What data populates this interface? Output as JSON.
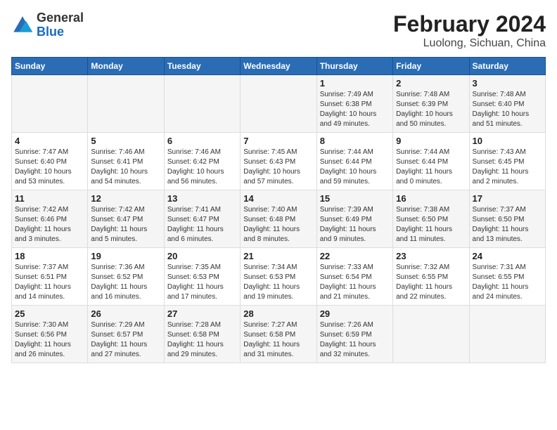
{
  "header": {
    "logo_general": "General",
    "logo_blue": "Blue",
    "title": "February 2024",
    "subtitle": "Luolong, Sichuan, China"
  },
  "days_of_week": [
    "Sunday",
    "Monday",
    "Tuesday",
    "Wednesday",
    "Thursday",
    "Friday",
    "Saturday"
  ],
  "weeks": [
    [
      {
        "day": "",
        "content": ""
      },
      {
        "day": "",
        "content": ""
      },
      {
        "day": "",
        "content": ""
      },
      {
        "day": "",
        "content": ""
      },
      {
        "day": "1",
        "content": "Sunrise: 7:49 AM\nSunset: 6:38 PM\nDaylight: 10 hours\nand 49 minutes."
      },
      {
        "day": "2",
        "content": "Sunrise: 7:48 AM\nSunset: 6:39 PM\nDaylight: 10 hours\nand 50 minutes."
      },
      {
        "day": "3",
        "content": "Sunrise: 7:48 AM\nSunset: 6:40 PM\nDaylight: 10 hours\nand 51 minutes."
      }
    ],
    [
      {
        "day": "4",
        "content": "Sunrise: 7:47 AM\nSunset: 6:40 PM\nDaylight: 10 hours\nand 53 minutes."
      },
      {
        "day": "5",
        "content": "Sunrise: 7:46 AM\nSunset: 6:41 PM\nDaylight: 10 hours\nand 54 minutes."
      },
      {
        "day": "6",
        "content": "Sunrise: 7:46 AM\nSunset: 6:42 PM\nDaylight: 10 hours\nand 56 minutes."
      },
      {
        "day": "7",
        "content": "Sunrise: 7:45 AM\nSunset: 6:43 PM\nDaylight: 10 hours\nand 57 minutes."
      },
      {
        "day": "8",
        "content": "Sunrise: 7:44 AM\nSunset: 6:44 PM\nDaylight: 10 hours\nand 59 minutes."
      },
      {
        "day": "9",
        "content": "Sunrise: 7:44 AM\nSunset: 6:44 PM\nDaylight: 11 hours\nand 0 minutes."
      },
      {
        "day": "10",
        "content": "Sunrise: 7:43 AM\nSunset: 6:45 PM\nDaylight: 11 hours\nand 2 minutes."
      }
    ],
    [
      {
        "day": "11",
        "content": "Sunrise: 7:42 AM\nSunset: 6:46 PM\nDaylight: 11 hours\nand 3 minutes."
      },
      {
        "day": "12",
        "content": "Sunrise: 7:42 AM\nSunset: 6:47 PM\nDaylight: 11 hours\nand 5 minutes."
      },
      {
        "day": "13",
        "content": "Sunrise: 7:41 AM\nSunset: 6:47 PM\nDaylight: 11 hours\nand 6 minutes."
      },
      {
        "day": "14",
        "content": "Sunrise: 7:40 AM\nSunset: 6:48 PM\nDaylight: 11 hours\nand 8 minutes."
      },
      {
        "day": "15",
        "content": "Sunrise: 7:39 AM\nSunset: 6:49 PM\nDaylight: 11 hours\nand 9 minutes."
      },
      {
        "day": "16",
        "content": "Sunrise: 7:38 AM\nSunset: 6:50 PM\nDaylight: 11 hours\nand 11 minutes."
      },
      {
        "day": "17",
        "content": "Sunrise: 7:37 AM\nSunset: 6:50 PM\nDaylight: 11 hours\nand 13 minutes."
      }
    ],
    [
      {
        "day": "18",
        "content": "Sunrise: 7:37 AM\nSunset: 6:51 PM\nDaylight: 11 hours\nand 14 minutes."
      },
      {
        "day": "19",
        "content": "Sunrise: 7:36 AM\nSunset: 6:52 PM\nDaylight: 11 hours\nand 16 minutes."
      },
      {
        "day": "20",
        "content": "Sunrise: 7:35 AM\nSunset: 6:53 PM\nDaylight: 11 hours\nand 17 minutes."
      },
      {
        "day": "21",
        "content": "Sunrise: 7:34 AM\nSunset: 6:53 PM\nDaylight: 11 hours\nand 19 minutes."
      },
      {
        "day": "22",
        "content": "Sunrise: 7:33 AM\nSunset: 6:54 PM\nDaylight: 11 hours\nand 21 minutes."
      },
      {
        "day": "23",
        "content": "Sunrise: 7:32 AM\nSunset: 6:55 PM\nDaylight: 11 hours\nand 22 minutes."
      },
      {
        "day": "24",
        "content": "Sunrise: 7:31 AM\nSunset: 6:55 PM\nDaylight: 11 hours\nand 24 minutes."
      }
    ],
    [
      {
        "day": "25",
        "content": "Sunrise: 7:30 AM\nSunset: 6:56 PM\nDaylight: 11 hours\nand 26 minutes."
      },
      {
        "day": "26",
        "content": "Sunrise: 7:29 AM\nSunset: 6:57 PM\nDaylight: 11 hours\nand 27 minutes."
      },
      {
        "day": "27",
        "content": "Sunrise: 7:28 AM\nSunset: 6:58 PM\nDaylight: 11 hours\nand 29 minutes."
      },
      {
        "day": "28",
        "content": "Sunrise: 7:27 AM\nSunset: 6:58 PM\nDaylight: 11 hours\nand 31 minutes."
      },
      {
        "day": "29",
        "content": "Sunrise: 7:26 AM\nSunset: 6:59 PM\nDaylight: 11 hours\nand 32 minutes."
      },
      {
        "day": "",
        "content": ""
      },
      {
        "day": "",
        "content": ""
      }
    ]
  ]
}
